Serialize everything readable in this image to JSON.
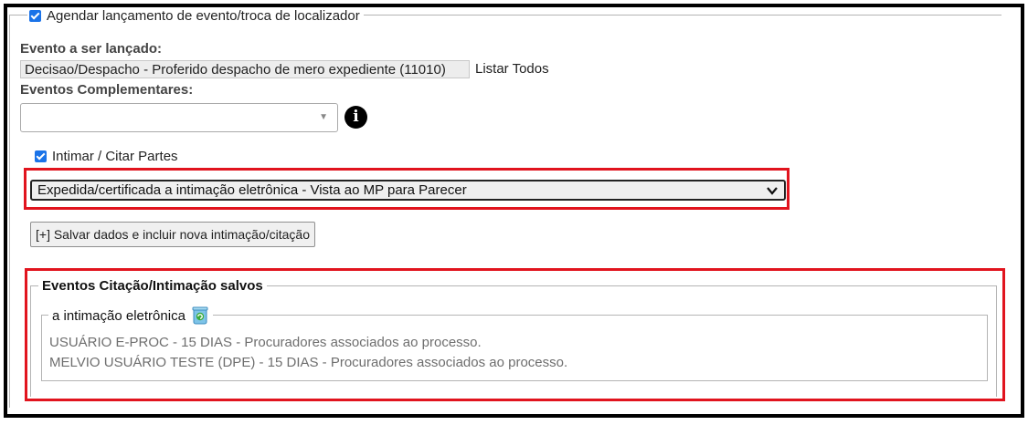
{
  "agendar": {
    "label": "Agendar lançamento de evento/troca de localizador",
    "checked": true
  },
  "evento": {
    "label": "Evento a ser lançado:",
    "value": "Decisao/Despacho - Proferido despacho de mero expediente (11010)",
    "listar_todos": "Listar Todos"
  },
  "complementares": {
    "label": "Eventos Complementares:",
    "value": "",
    "arrow": "▼"
  },
  "info_icon": "i",
  "intimar": {
    "label": "Intimar / Citar Partes",
    "checked": true
  },
  "intimacao_select": {
    "value": "Expedida/certificada a intimação eletrônica - Vista ao MP para Parecer",
    "chevron": "⌄"
  },
  "salvar_button": "[+] Salvar dados e incluir nova intimação/citação",
  "eventos_salvos": {
    "title": "Eventos Citação/Intimação salvos",
    "group_title": "a intimação eletrônica",
    "rows": [
      "USUÁRIO E-PROC - 15 DIAS - Procuradores associados ao processo.",
      "MELVIO USUÁRIO TESTE (DPE) - 15 DIAS - Procuradores associados ao processo."
    ]
  },
  "colors": {
    "highlight_border": "#e1141e",
    "checkbox": "#1a73e8"
  }
}
